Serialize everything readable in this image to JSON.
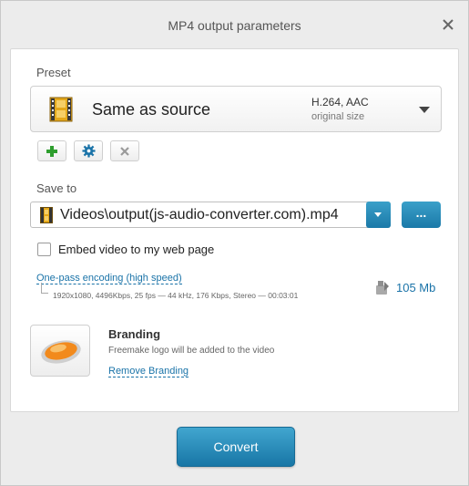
{
  "window": {
    "title": "MP4 output parameters",
    "close_icon": "close-icon"
  },
  "preset": {
    "label": "Preset",
    "name": "Same as source",
    "codec": "H.264, AAC",
    "size": "original size",
    "icon": "film-strip-icon"
  },
  "preset_actions": {
    "add_icon": "plus-icon",
    "settings_icon": "gear-icon",
    "delete_icon": "x-icon",
    "add_color": "#2e9e2e",
    "settings_color": "#1a73a8",
    "delete_color": "#9a9a9a"
  },
  "save_to": {
    "label": "Save to",
    "value": "Videos\\output(js-audio-converter.com).mp4",
    "browse_label": "...",
    "file_icon": "film-strip-icon"
  },
  "embed": {
    "label": "Embed video to my web page",
    "checked": false
  },
  "encoding": {
    "mode": "One-pass encoding (high speed)",
    "details": "1920x1080, 4496Kbps, 25 fps — 44 kHz, 176 Kbps, Stereo — 00:03:01",
    "size": "105 Mb",
    "size_icon": "file-size-icon"
  },
  "branding": {
    "title": "Branding",
    "description": "Freemake logo will be added to the video",
    "remove_label": "Remove Branding",
    "logo_icon": "freemake-logo-icon"
  },
  "convert_label": "Convert",
  "colors": {
    "accent": "#1b79a8",
    "link": "#1a73a8"
  }
}
